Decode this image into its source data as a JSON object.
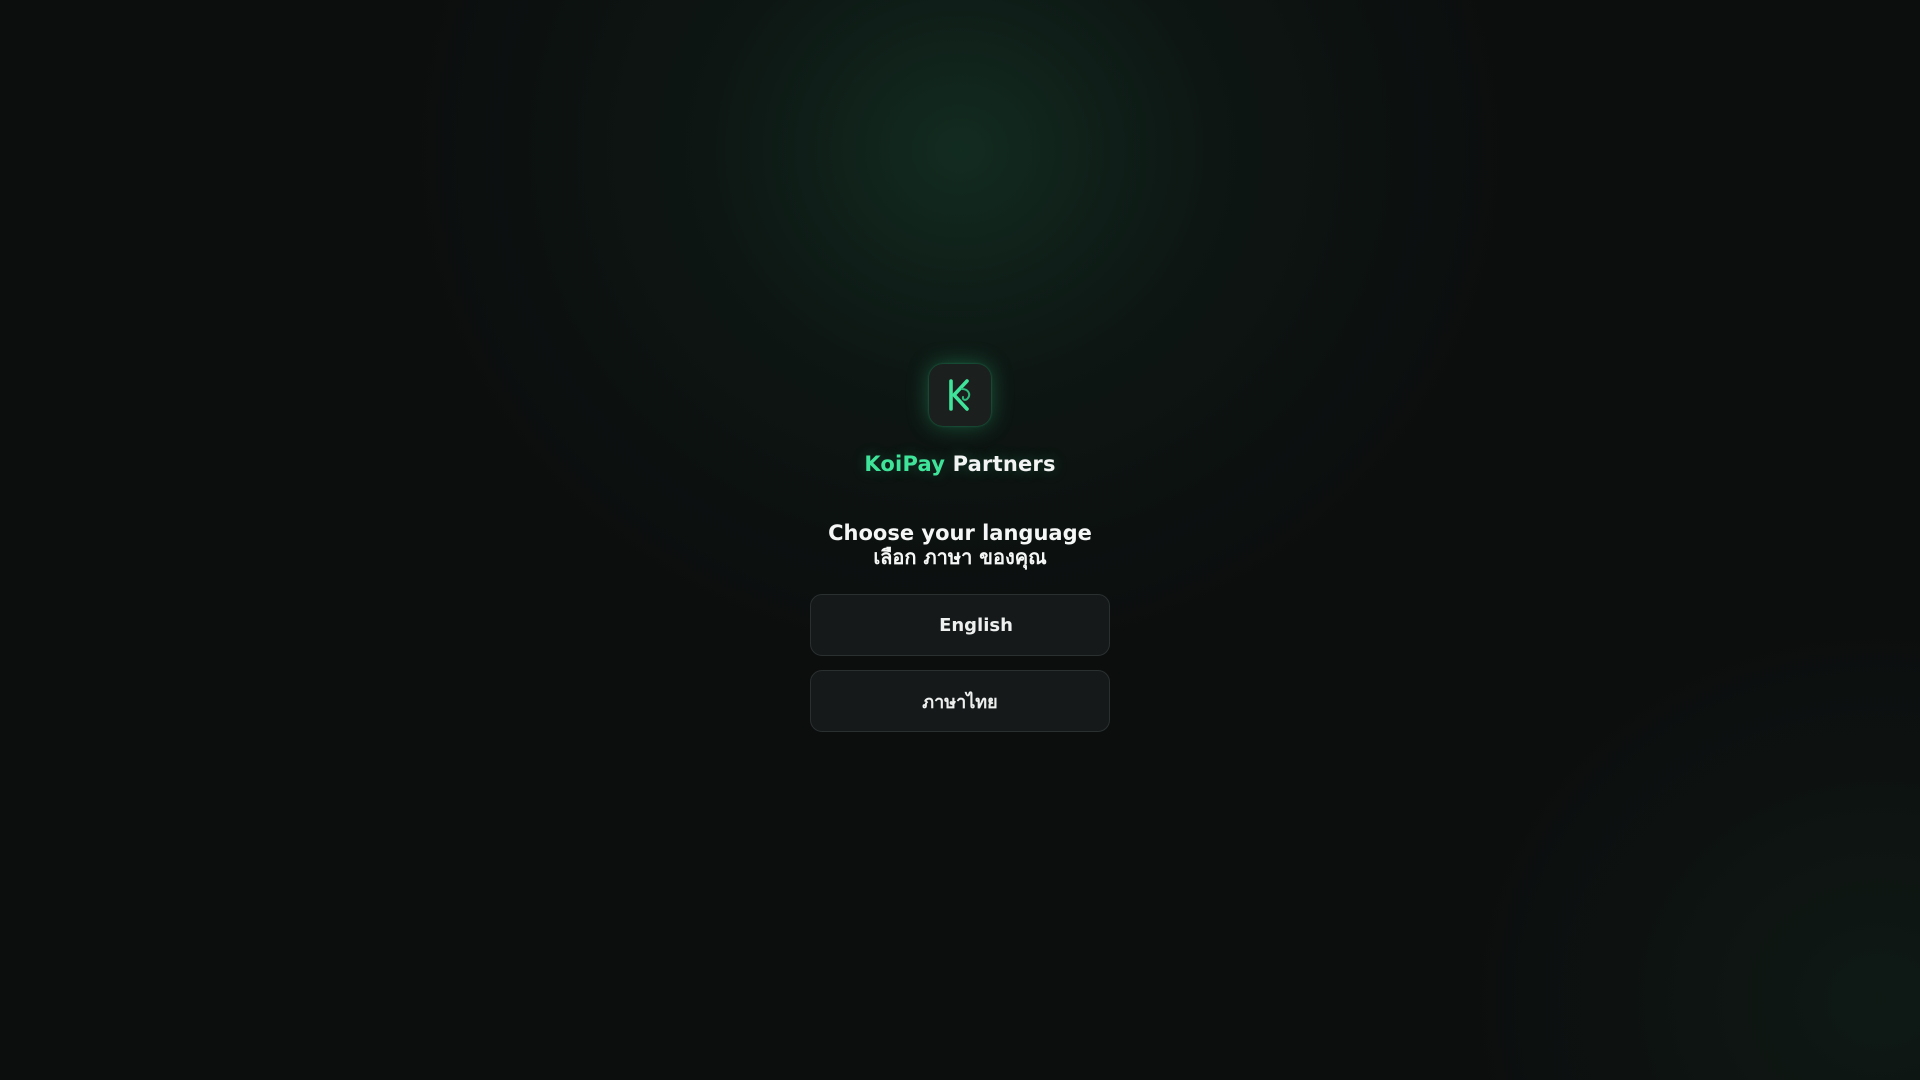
{
  "brand": {
    "name_accent": "KoiPay",
    "name_rest": "Partners",
    "logo_icon": "koi-k-logo-icon",
    "accent_color": "#3fe39a"
  },
  "prompt": {
    "title": "Choose your language",
    "subtitle": "เลือก ภาษา ของคุณ"
  },
  "languages": [
    {
      "label": "English"
    },
    {
      "label": "ภาษาไทย"
    }
  ]
}
